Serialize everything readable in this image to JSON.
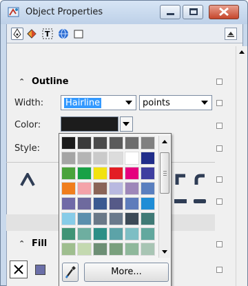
{
  "window": {
    "title": "Object Properties"
  },
  "tabs": [
    {
      "name": "outline-tab-icon",
      "selected": true
    },
    {
      "name": "fill-tab-icon",
      "selected": false
    },
    {
      "name": "text-frame-tab-icon",
      "selected": false
    },
    {
      "name": "internet-tab-icon",
      "selected": false
    },
    {
      "name": "transparency-tab-icon",
      "selected": false
    }
  ],
  "outline": {
    "header": "Outline",
    "width_label": "Width:",
    "width_value": "Hairline",
    "units_value": "points",
    "color_label": "Color:",
    "color_value": "#1c1c1c",
    "style_label": "Style:"
  },
  "fill": {
    "header": "Fill"
  },
  "palette": {
    "more_label": "More...",
    "swatches": [
      "#1b1b1b",
      "#3a3a3a",
      "#4b4b4b",
      "#5b5b5b",
      "#6d6d6d",
      "#808080",
      "#a5a5a5",
      "#b5b5b5",
      "#cacaca",
      "#dcdcdc",
      "#ffffff",
      "#202d8a",
      "#4aa33c",
      "#18a146",
      "#f2e20f",
      "#e31e24",
      "#e5007e",
      "#3e3ea0",
      "#f07e1d",
      "#f4a3a9",
      "#8a6457",
      "#b9b9e0",
      "#9e87b9",
      "#5a7fbf",
      "#706aa7",
      "#6e6a9e",
      "#3b5a91",
      "#565a88",
      "#5e7cbb",
      "#1f8dd6",
      "#87cce8",
      "#5b8fad",
      "#6a7988",
      "#6a7a8c",
      "#3c4a57",
      "#3f7a76",
      "#409476",
      "#6eaea0",
      "#2d8f87",
      "#5ca3a8",
      "#7dbec4",
      "#62a89e",
      "#9fbe8f",
      "#c4d9b0",
      "#6d8f75",
      "#7aa07d",
      "#8fb89b",
      "#a8c5b4"
    ]
  }
}
